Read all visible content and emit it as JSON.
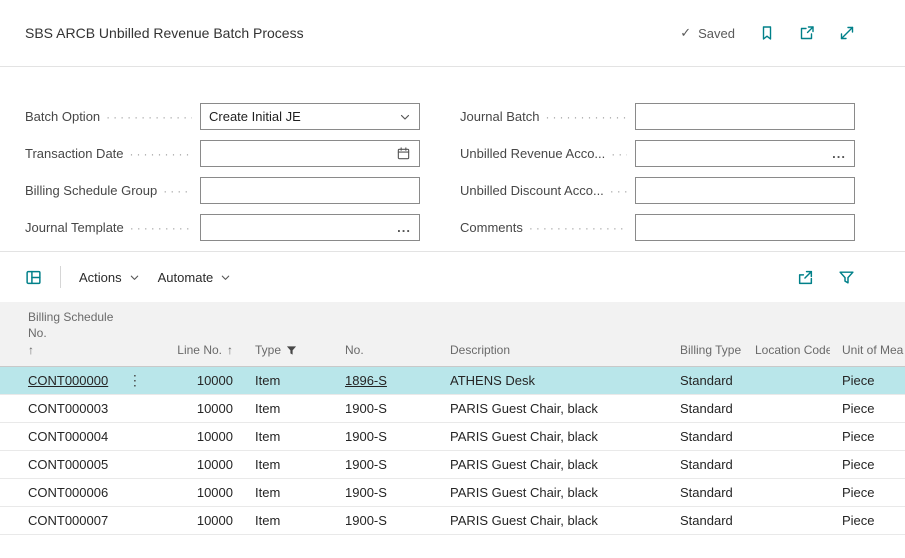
{
  "colors": {
    "accent": "#008089",
    "selected_row": "#b9e6ea",
    "table_header_bg": "#f2f2f2"
  },
  "header": {
    "title": "SBS ARCB Unbilled Revenue Batch Process",
    "saved": "Saved",
    "icons": {
      "check": "✓"
    }
  },
  "form": {
    "fields_left": [
      {
        "label": "Batch Option",
        "value": "Create Initial JE",
        "control": "dropdown"
      },
      {
        "label": "Transaction Date",
        "value": "",
        "control": "date"
      },
      {
        "label": "Billing Schedule Group",
        "value": "",
        "control": "text"
      },
      {
        "label": "Journal Template",
        "value": "",
        "control": "assist"
      }
    ],
    "fields_right": [
      {
        "label": "Journal Batch",
        "value": "",
        "control": "text"
      },
      {
        "label": "Unbilled Revenue Acco...",
        "value": "",
        "control": "assist"
      },
      {
        "label": "Unbilled Discount Acco...",
        "value": "",
        "control": "text"
      },
      {
        "label": "Comments",
        "value": "",
        "control": "text"
      }
    ],
    "icons": {
      "assist_edit": "..."
    }
  },
  "toolbar": {
    "actions": "Actions",
    "automate": "Automate"
  },
  "table": {
    "icons": {
      "more": "⋮"
    },
    "columns": [
      {
        "label": "Billing Schedule No.",
        "sort": "↑"
      },
      {
        "label": "Line No.",
        "sort": "↑"
      },
      {
        "label": "Type",
        "filtered": true
      },
      {
        "label": "No."
      },
      {
        "label": "Description"
      },
      {
        "label": "Billing Type"
      },
      {
        "label": "Location Code"
      },
      {
        "label": "Unit of Mea"
      }
    ],
    "rows": [
      {
        "billing_schedule_no": "CONT000000",
        "line_no": "10000",
        "type": "Item",
        "no": "1896-S",
        "description": "ATHENS Desk",
        "billing_type": "Standard",
        "location_code": "",
        "unit_of_measure": "Piece",
        "selected": true
      },
      {
        "billing_schedule_no": "CONT000003",
        "line_no": "10000",
        "type": "Item",
        "no": "1900-S",
        "description": "PARIS Guest Chair, black",
        "billing_type": "Standard",
        "location_code": "",
        "unit_of_measure": "Piece",
        "selected": false
      },
      {
        "billing_schedule_no": "CONT000004",
        "line_no": "10000",
        "type": "Item",
        "no": "1900-S",
        "description": "PARIS Guest Chair, black",
        "billing_type": "Standard",
        "location_code": "",
        "unit_of_measure": "Piece",
        "selected": false
      },
      {
        "billing_schedule_no": "CONT000005",
        "line_no": "10000",
        "type": "Item",
        "no": "1900-S",
        "description": "PARIS Guest Chair, black",
        "billing_type": "Standard",
        "location_code": "",
        "unit_of_measure": "Piece",
        "selected": false
      },
      {
        "billing_schedule_no": "CONT000006",
        "line_no": "10000",
        "type": "Item",
        "no": "1900-S",
        "description": "PARIS Guest Chair, black",
        "billing_type": "Standard",
        "location_code": "",
        "unit_of_measure": "Piece",
        "selected": false
      },
      {
        "billing_schedule_no": "CONT000007",
        "line_no": "10000",
        "type": "Item",
        "no": "1900-S",
        "description": "PARIS Guest Chair, black",
        "billing_type": "Standard",
        "location_code": "",
        "unit_of_measure": "Piece",
        "selected": false
      }
    ]
  }
}
